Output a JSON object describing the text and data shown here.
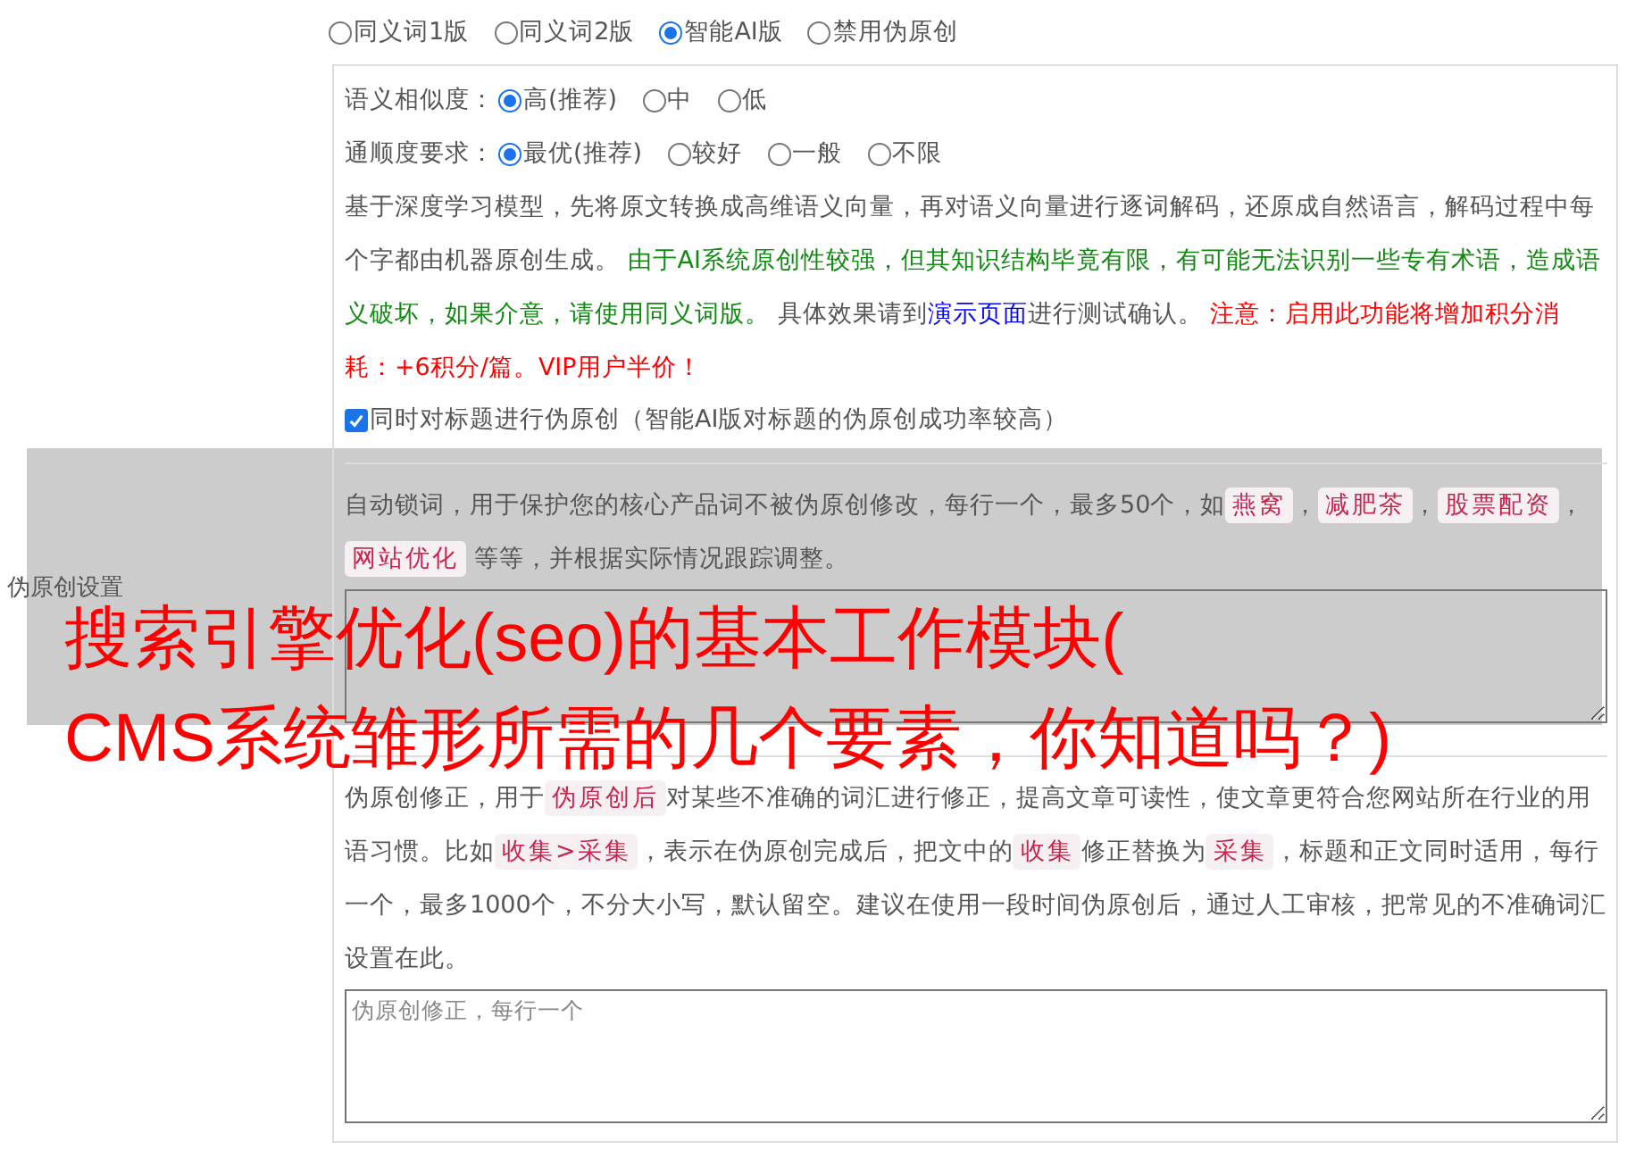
{
  "section_label": "伪原创设置",
  "modes": [
    {
      "label": "同义词1版",
      "selected": false
    },
    {
      "label": "同义词2版",
      "selected": false
    },
    {
      "label": "智能AI版",
      "selected": true
    },
    {
      "label": "禁用伪原创",
      "selected": false
    }
  ],
  "settings": [
    {
      "label": "语义相似度：",
      "options": [
        {
          "label": "高(推荐)",
          "selected": true
        },
        {
          "label": "中",
          "selected": false
        },
        {
          "label": "低",
          "selected": false
        }
      ]
    },
    {
      "label": "通顺度要求：",
      "options": [
        {
          "label": "最优(推荐)",
          "selected": true
        },
        {
          "label": "较好",
          "selected": false
        },
        {
          "label": "一般",
          "selected": false
        },
        {
          "label": "不限",
          "selected": false
        }
      ]
    }
  ],
  "ai_description": [
    {
      "kind": "plain",
      "text": "基于深度学习模型，先将原文转换成高维语义向量，再对语义向量进行逐词解码，还原成自然语言，解码过程中每个字都由机器原创生成。 "
    },
    {
      "kind": "green",
      "text": "由于AI系统原创性较强，但其知识结构毕竟有限，有可能无法识别一些专有术语，造成语义破坏，如果介意，请使用同义词版。"
    },
    {
      "kind": "plain",
      "text": " 具体效果请到"
    },
    {
      "kind": "link",
      "text": "演示页面"
    },
    {
      "kind": "plain",
      "text": "进行测试确认。 "
    },
    {
      "kind": "red",
      "text": "注意：启用此功能将增加积分消耗：+6积分/篇。VIP用户半价！"
    }
  ],
  "title_option": {
    "label": "同时对标题进行伪原创（智能AI版对标题的伪原创成功率较高）",
    "checked": true
  },
  "lock_words": {
    "description": [
      {
        "kind": "plain",
        "text": "自动锁词，用于保护您的核心产品词不被伪原创修改，每行一个，最多50个，如"
      },
      {
        "kind": "tag",
        "text": "燕窝"
      },
      {
        "kind": "plain",
        "text": "，"
      },
      {
        "kind": "tag",
        "text": "减肥茶"
      },
      {
        "kind": "plain",
        "text": "，"
      },
      {
        "kind": "tag",
        "text": "股票配资"
      },
      {
        "kind": "plain",
        "text": "，"
      },
      {
        "kind": "tag",
        "text": "网站优化"
      },
      {
        "kind": "plain",
        "text": " 等等，并根据实际情况跟踪调整。"
      }
    ]
  },
  "corrections": {
    "description": [
      {
        "kind": "plain",
        "text": "伪原创修正，用于"
      },
      {
        "kind": "tag",
        "text": "伪原创后"
      },
      {
        "kind": "plain",
        "text": "对某些不准确的词汇进行修正，提高文章可读性，使文章更符合您网站所在行业的用语习惯。比如"
      },
      {
        "kind": "tag",
        "text": "收集>采集"
      },
      {
        "kind": "plain",
        "text": "，表示在伪原创完成后，把文中的"
      },
      {
        "kind": "tag",
        "text": "收集"
      },
      {
        "kind": "plain",
        "text": "修正替换为"
      },
      {
        "kind": "tag",
        "text": "采集"
      },
      {
        "kind": "plain",
        "text": "，标题和正文同时适用，每行一个，最多1000个，不分大小写，默认留空。建议在使用一段时间伪原创后，通过人工审核，把常见的不准确词汇设置在此。"
      }
    ],
    "placeholder": "伪原创修正，每行一个"
  },
  "overlay": {
    "title_lines": [
      "搜索引擎优化(seo)的基本工作模块(",
      "CMS系统雏形所需的几个要素，你知道吗？)"
    ]
  }
}
